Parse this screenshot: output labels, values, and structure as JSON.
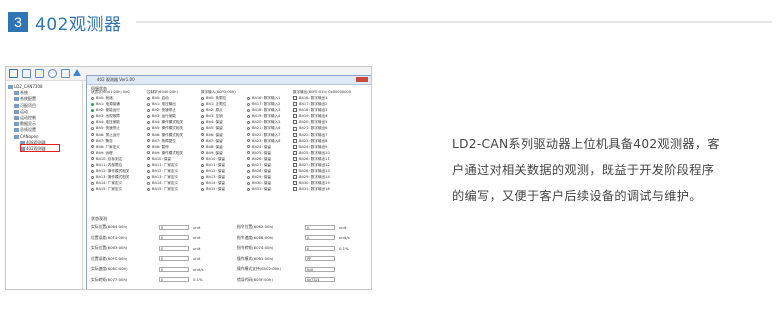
{
  "section": {
    "number": "3",
    "title": "402观测器"
  },
  "tree": {
    "items": [
      "LD2_CAN7308",
      "系统",
      "系统配置",
      "可配项目",
      "运动",
      "运动控制",
      "数据显示",
      "总线设置",
      "CANopen",
      "408观测器",
      "402观测器"
    ]
  },
  "window": {
    "title": "402 观测器 Ver1.00",
    "status_title": "伺服状态"
  },
  "columns": [
    {
      "header": "状态字(6041:00h) 0x0",
      "type": "radio",
      "items": [
        "Bit0: 就绪",
        "Bit1: 电源接通",
        "Bit2: 使能运行",
        "Bit3: 出现故障",
        "Bit4: 电压使能",
        "Bit5: 快速停止",
        "Bit6: 禁止运行",
        "Bit7: 警告",
        "Bit8: 厂家定义",
        "Bit9: 远程",
        "Bit10: 目标到达",
        "Bit11: 内部限位",
        "Bit12: 操作模式相关",
        "Bit13: 操作模式相关",
        "Bit14: 厂家定义",
        "Bit15: 厂家定义"
      ],
      "on": [
        1,
        2
      ]
    },
    {
      "header": "控制字(6040:00h)",
      "type": "radio",
      "items": [
        "Bit0: 启动",
        "Bit1: 电压输出",
        "Bit2: 快速停止",
        "Bit3: 运行使能",
        "Bit4: 操作模式相关",
        "Bit5: 操作模式相关",
        "Bit6: 操作模式相关",
        "Bit7: 故障复位",
        "Bit8: 暂停",
        "Bit9: 操作模式相关",
        "Bit10: 保留",
        "Bit11: 厂家定义",
        "Bit12: 厂家定义",
        "Bit13: 厂家定义",
        "Bit14: 厂家定义",
        "Bit15: 厂家定义"
      ],
      "on": []
    },
    {
      "header": "数字输入(60FD:00h)",
      "type": "radio",
      "items": [
        "Bit0: 负限位",
        "Bit1: 正限位",
        "Bit2: 原点",
        "Bit3: 互锁",
        "Bit4: 保留",
        "Bit5: 保留",
        "Bit6: 保留",
        "Bit7: 保留",
        "Bit8: 保留",
        "Bit9: 保留",
        "Bit10: 保留",
        "Bit11: 保留",
        "Bit12: 保留",
        "Bit13: 保留",
        "Bit14: 保留",
        "Bit15: 保留"
      ],
      "on": []
    },
    {
      "header": "",
      "type": "radio",
      "items": [
        "Bit16: 数字输入1",
        "Bit17: 数字输入2",
        "Bit18: 数字输入3",
        "Bit19: 数字输入4",
        "Bit20: 数字输入5",
        "Bit21: 数字输入6",
        "Bit22: 数字输入7",
        "Bit23: 数字输入8",
        "Bit24: 保留",
        "Bit25: 保留",
        "Bit26: 保留",
        "Bit27: 保留",
        "Bit28: 保留",
        "Bit29: 保留",
        "Bit30: 保留",
        "Bit31: 保留"
      ],
      "on": []
    },
    {
      "header": "数字输出(60FE:01h) 0x00000000",
      "type": "check",
      "items": [
        "Bit16: 数字输出1",
        "Bit17: 数字输出2",
        "Bit18: 数字输出3",
        "Bit19: 数字输出4",
        "Bit20: 数字输出5",
        "Bit21: 数字输出6",
        "Bit22: 数字输出7",
        "Bit23: 数字输出8",
        "Bit24: 数字输出9",
        "Bit25: 数字输出10",
        "Bit26: 数字输出11",
        "Bit27: 数字输出12",
        "Bit28: 数字输出13",
        "Bit29: 数字输出14",
        "Bit30: 数字输出15",
        "Bit31: 数字输出16"
      ],
      "on": []
    }
  ],
  "status_section": "状态观测",
  "fields_left": [
    {
      "label": "实际位置(6064:00h)",
      "value": "0",
      "unit": "unit"
    },
    {
      "label": "位置误差(60F4:00h)",
      "value": "0",
      "unit": "unit"
    },
    {
      "label": "实际位置(6063:00h)",
      "value": "0",
      "unit": "unit"
    },
    {
      "label": "位置误差(60FC:00h)",
      "value": "0",
      "unit": "unit"
    },
    {
      "label": "实际速度(606C:00h)",
      "value": "0",
      "unit": "unit/s"
    },
    {
      "label": "实际转矩(6077:00h)",
      "value": "0",
      "unit": "0.1%"
    }
  ],
  "fields_right": [
    {
      "label": "指令位置(6062:00h)",
      "value": "0",
      "unit": "unit"
    },
    {
      "label": "指令速度(606B:00h)",
      "value": "0",
      "unit": "unit/s"
    },
    {
      "label": "指令转矩(6074:00h)",
      "value": "0",
      "unit": "0.1%"
    },
    {
      "label": "操作模式(6061:00h)",
      "value": "PP",
      "unit": ""
    },
    {
      "label": "操作模式支持(6502:00h)",
      "value": "0x0",
      "unit": ""
    },
    {
      "label": "错误代码(603F:00h)",
      "value": "0x7321",
      "unit": ""
    }
  ],
  "description": [
    "LD2-CAN系列驱动器上位机具备402观测器，客",
    "户通过对相关数据的观测，既益于开发阶段程序",
    "的编写，又便于客户后续设备的调试与维护。"
  ]
}
